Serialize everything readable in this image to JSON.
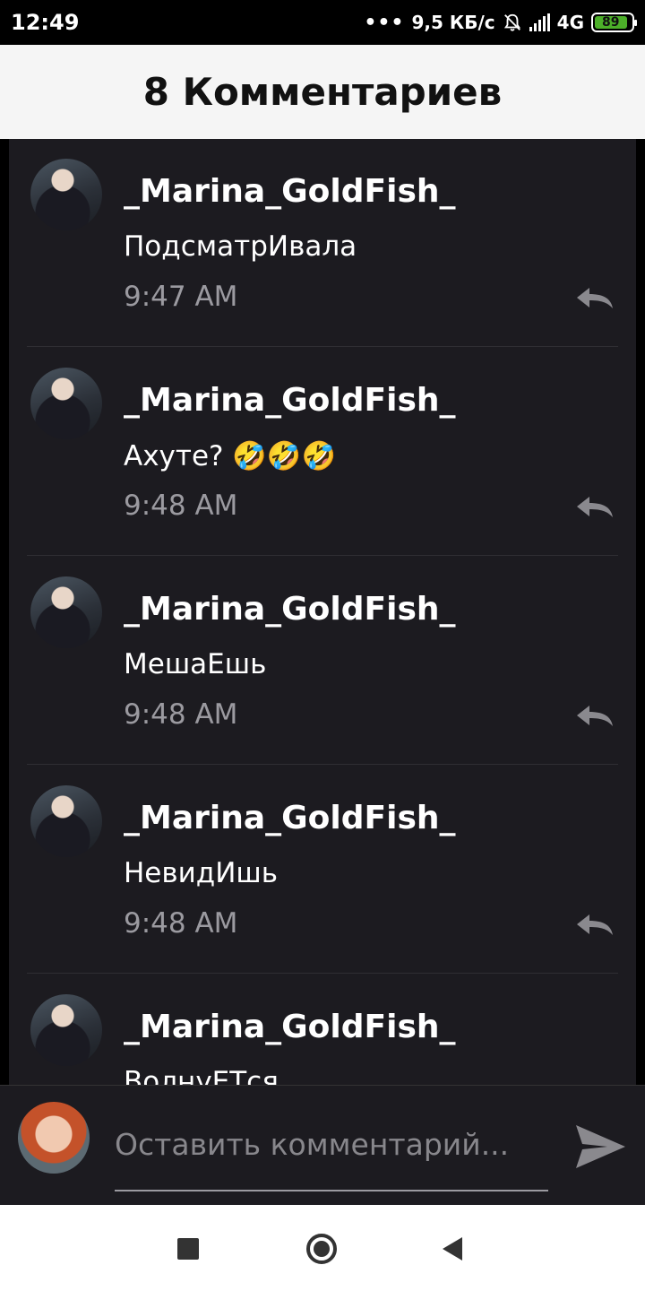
{
  "status_bar": {
    "time": "12:49",
    "dots": "•••",
    "network_speed": "9,5 КБ/с",
    "network_type": "4G",
    "battery": "89",
    "battery_level_percent": 89,
    "colors": {
      "battery_fill": "#4caf29"
    }
  },
  "header": {
    "title": "8 Комментариев"
  },
  "comments": [
    {
      "username": "_Marina_GoldFish_",
      "text": "ПодсматрИвала",
      "time": "9:47 AM"
    },
    {
      "username": "_Marina_GoldFish_",
      "text": "Ахуте? 🤣🤣🤣",
      "time": "9:48 AM"
    },
    {
      "username": "_Marina_GoldFish_",
      "text": "МешаЕшь",
      "time": "9:48 AM"
    },
    {
      "username": "_Marina_GoldFish_",
      "text": "НевидИшь",
      "time": "9:48 AM"
    },
    {
      "username": "_Marina_GoldFish_",
      "text": "ВолнуЕТся",
      "time": ""
    }
  ],
  "input_bar": {
    "placeholder": "Оставить комментарий..."
  },
  "icons": {
    "reply": "reply-arrow-icon",
    "send": "send-arrow-icon",
    "bell": "bell-off-icon"
  },
  "theme": {
    "background": "#1c1b20",
    "header_bg": "#f5f5f5",
    "time_color": "#9b9aa0"
  }
}
